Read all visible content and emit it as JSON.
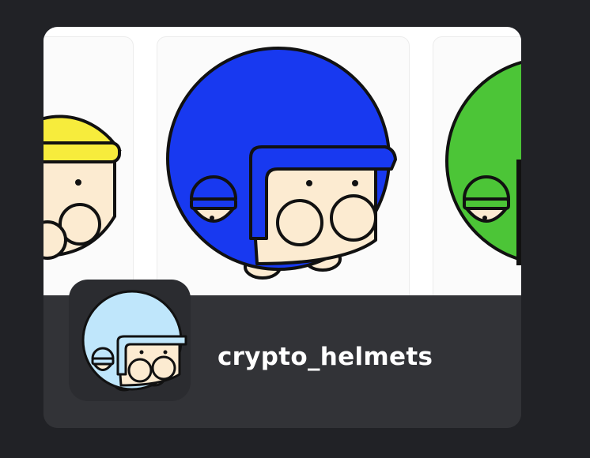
{
  "collection": {
    "name": "crypto_helmets"
  },
  "banner": {
    "items": [
      {
        "icon": "yellow-helmet-character",
        "helmet_color": "#f7ec3c"
      },
      {
        "icon": "blue-helmet-character",
        "helmet_color": "#1839f0"
      },
      {
        "icon": "green-helmet-character",
        "helmet_color": "#4cc537"
      }
    ]
  },
  "avatar": {
    "icon": "light-blue-helmet-character",
    "helmet_color": "#bfe6fb",
    "background_color": "#2b2c30"
  },
  "colors": {
    "page_background": "#212226",
    "card_background": "#323337",
    "face": "#fcebd1",
    "outline": "#111111"
  }
}
